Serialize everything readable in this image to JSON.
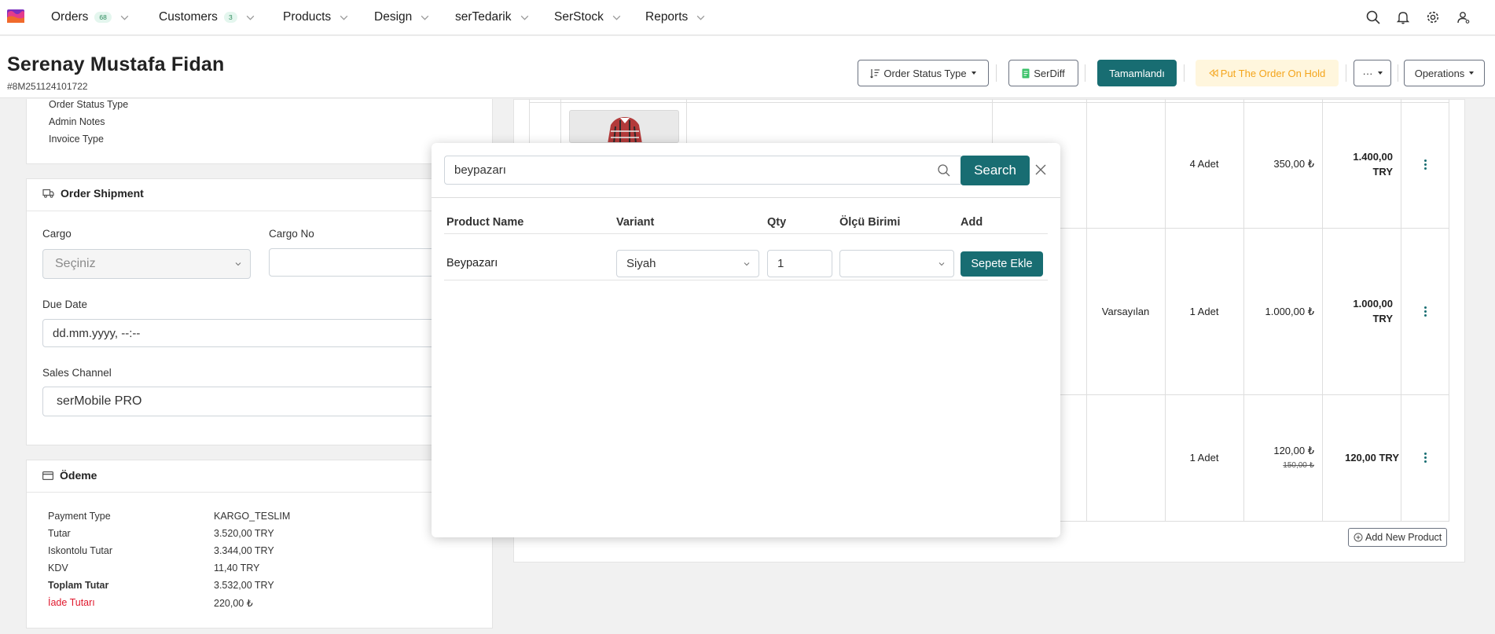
{
  "nav": {
    "items": [
      {
        "label": "Orders",
        "badge": "68"
      },
      {
        "label": "Customers",
        "badge": "3"
      },
      {
        "label": "Products"
      },
      {
        "label": "Design"
      },
      {
        "label": "serTedarik"
      },
      {
        "label": "SerStock"
      },
      {
        "label": "Reports"
      }
    ],
    "icons": [
      "search-icon",
      "bell-icon",
      "gear-icon",
      "user-icon"
    ]
  },
  "header": {
    "title": "Serenay Mustafa Fidan",
    "order_no": "#8M251124101722",
    "buttons": {
      "order_status": "Order Status Type",
      "serdiff": "SerDiff",
      "complete": "Tamamlandı",
      "hold": "Put The Order On Hold",
      "more": "···",
      "operations": "Operations"
    }
  },
  "order_info": {
    "lines": [
      "Order Status Type",
      "Admin Notes",
      "Invoice Type"
    ]
  },
  "shipment": {
    "title": "Order Shipment",
    "cargo_label": "Cargo",
    "cargo_placeholder": "Seçiniz",
    "cargo_no_label": "Cargo No",
    "due_date_label": "Due Date",
    "due_date_value": "dd.mm.yyyy, --:--",
    "sales_channel_label": "Sales Channel",
    "sales_channel_value": "serMobile PRO"
  },
  "payment": {
    "title": "Ödeme",
    "rows": [
      {
        "label": "Payment Type",
        "value": "KARGO_TESLIM"
      },
      {
        "label": "Tutar",
        "value": "3.520,00 TRY"
      },
      {
        "label": "Iskontolu Tutar",
        "value": "3.344,00 TRY"
      },
      {
        "label": "KDV",
        "value": "11,40 TRY"
      },
      {
        "label": "Toplam Tutar",
        "value": "3.532,00 TRY"
      },
      {
        "label": "İade Tutarı",
        "value": "220,00 ₺"
      }
    ]
  },
  "order_table": {
    "rows": [
      {
        "variant": "",
        "qty": "4 Adet",
        "price": "350,00 ₺",
        "total_line1": "1.400,00",
        "total_line2": "TRY"
      },
      {
        "variant": "Varsayılan",
        "qty": "1 Adet",
        "price": "1.000,00 ₺",
        "total_line1": "1.000,00",
        "total_line2": "TRY"
      },
      {
        "variant": "",
        "qty": "1 Adet",
        "price": "120,00 ₺",
        "old_price": "150,00 ₺",
        "total_line1": "120,00 TRY",
        "total_line2": ""
      }
    ],
    "add_new": "Add New Product"
  },
  "modal": {
    "search_value": "beypazarı",
    "search_button": "Search",
    "columns": [
      "Product Name",
      "Variant",
      "Qty",
      "Ölçü Birimi",
      "Add"
    ],
    "result": {
      "name": "Beypazarı",
      "variant": "Siyah",
      "qty": "1",
      "unit": "",
      "add_button": "Sepete Ekle"
    }
  },
  "colors": {
    "primary": "#186d72",
    "warn_bg": "#fff6dd",
    "warn_text": "#f4a51c",
    "refund_red": "#e0182d"
  }
}
